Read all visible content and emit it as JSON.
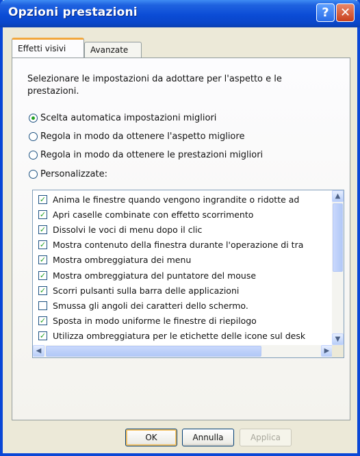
{
  "window": {
    "title": "Opzioni prestazioni",
    "help_label": "?",
    "close_label": "✕"
  },
  "tabs": [
    {
      "label": "Effetti visivi"
    },
    {
      "label": "Avanzate"
    }
  ],
  "description": "Selezionare le impostazioni da adottare per l'aspetto e le prestazioni.",
  "radios": [
    {
      "label": "Scelta automatica impostazioni migliori",
      "selected": true
    },
    {
      "label": "Regola in modo da ottenere l'aspetto migliore",
      "selected": false
    },
    {
      "label": "Regola in modo da ottenere le prestazioni migliori",
      "selected": false
    },
    {
      "label": "Personalizzate:",
      "selected": false
    }
  ],
  "effects": [
    {
      "label": "Anima le finestre quando vengono ingrandite o ridotte ad",
      "checked": true
    },
    {
      "label": "Apri caselle combinate con effetto scorrimento",
      "checked": true
    },
    {
      "label": "Dissolvi le voci di menu dopo il clic",
      "checked": true
    },
    {
      "label": "Mostra contenuto della finestra durante l'operazione di tra",
      "checked": true
    },
    {
      "label": "Mostra ombreggiatura dei menu",
      "checked": true
    },
    {
      "label": "Mostra ombreggiatura del puntatore del mouse",
      "checked": true
    },
    {
      "label": "Scorri pulsanti sulla barra delle applicazioni",
      "checked": true
    },
    {
      "label": "Smussa gli angoli dei caratteri dello schermo.",
      "checked": false
    },
    {
      "label": "Sposta in modo uniforme le finestre di riepilogo",
      "checked": true
    },
    {
      "label": "Utilizza ombreggiatura per le etichette delle icone sul desk",
      "checked": true
    }
  ],
  "buttons": {
    "ok": "OK",
    "cancel": "Annulla",
    "apply": "Applica"
  },
  "colors": {
    "titlebar": "#0b4cd6",
    "dialog_bg": "#ece9d8",
    "check": "#21a121"
  }
}
